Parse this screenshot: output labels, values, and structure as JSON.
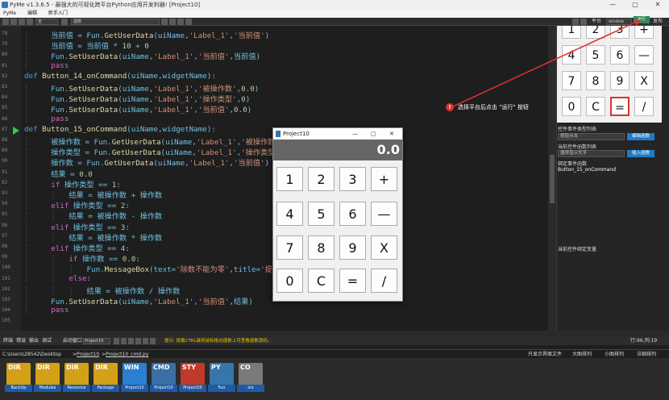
{
  "window": {
    "title": "PyMe v1.3.6.5 - 最强大的可视化跨平台Python应用开发利器! [Project10]",
    "controls": [
      "—",
      "▢",
      "✕"
    ]
  },
  "menu": [
    "PyMe",
    "编辑",
    "新手入门"
  ],
  "toolbar": {
    "file_select": "全",
    "func_select": "函数",
    "platform_label": "平台",
    "platform_value": "window",
    "run_label": "运行",
    "publish_label": "发布"
  },
  "editor": {
    "lines": [
      {
        "n": "78",
        "html": "<span class=\"guide\">┆ </span>    当前值 = Fun.<span class=\"fn\">GetUserData</span>(uiName,<span class=\"str\">'Label_1'</span>,<span class=\"str\">'当前值'</span>)"
      },
      {
        "n": "79",
        "html": "<span class=\"guide\">┆ </span>    当前值 = 当前值 * <span class=\"num\">10</span> + <span class=\"num\">0</span>"
      },
      {
        "n": "80",
        "html": "<span class=\"guide\">┆ </span>    Fun.<span class=\"fn\">SetUserData</span>(uiName,<span class=\"str\">'Label_1'</span>,<span class=\"str\">'当前值'</span>,当前值)"
      },
      {
        "n": "81",
        "html": "<span class=\"guide\">┆ </span>    <span class=\"kw\">pass</span>"
      },
      {
        "n": "82",
        "html": "<span class=\"def\">def</span> <span class=\"fn\">Button_14_onCommand</span>(uiName,widgetName):"
      },
      {
        "n": "83",
        "html": "<span class=\"guide\">┆ </span>    Fun.<span class=\"fn\">SetUserData</span>(uiName,<span class=\"str\">'Label_1'</span>,<span class=\"str\">'被操作数'</span>,<span class=\"num\">0.0</span>)"
      },
      {
        "n": "84",
        "html": "<span class=\"guide\">┆ </span>    Fun.<span class=\"fn\">SetUserData</span>(uiName,<span class=\"str\">'Label_1'</span>,<span class=\"str\">'操作类型'</span>,<span class=\"num\">0</span>)"
      },
      {
        "n": "85",
        "html": "<span class=\"guide\">┆ </span>    Fun.<span class=\"fn\">SetUserData</span>(uiName,<span class=\"str\">'Label_1'</span>,<span class=\"str\">'当前值'</span>,<span class=\"num\">0.0</span>)"
      },
      {
        "n": "86",
        "html": "<span class=\"guide\">┆ </span>    <span class=\"kw\">pass</span>"
      },
      {
        "n": "87",
        "html": "<span class=\"def\">def</span> <span class=\"fn\">Button_15_onCommand</span>(uiName,widgetName):"
      },
      {
        "n": "88",
        "html": "<span class=\"guide\">┆ </span>    被操作数 = Fun.<span class=\"fn\">GetUserData</span>(uiName,<span class=\"str\">'Label_1'</span>,<span class=\"str\">'被操作数'</span>)"
      },
      {
        "n": "89",
        "html": "<span class=\"guide\">┆ </span>    操作类型 = Fun.<span class=\"fn\">GetUserData</span>(uiName,<span class=\"str\">'Label_1'</span>,<span class=\"str\">'操作类型'</span>)"
      },
      {
        "n": "90",
        "html": "<span class=\"guide\">┆ </span>    操作数 = Fun.<span class=\"fn\">GetUserData</span>(uiName,<span class=\"str\">'Label_1'</span>,<span class=\"str\">'当前值'</span>)"
      },
      {
        "n": "91",
        "html": "<span class=\"guide\">┆ </span>    结果 = <span class=\"num\">0.0</span>"
      },
      {
        "n": "92",
        "html": "<span class=\"guide\">┆ </span>    <span class=\"kw\">if</span> 操作类型 == <span class=\"num\">1</span>:"
      },
      {
        "n": "93",
        "html": "<span class=\"guide\">┆ </span>    <span class=\"guide\">┆ </span>  结果 = 被操作数 + 操作数"
      },
      {
        "n": "94",
        "html": "<span class=\"guide\">┆ </span>    <span class=\"kw\">elif</span> 操作类型 == <span class=\"num\">2</span>:"
      },
      {
        "n": "95",
        "html": "<span class=\"guide\">┆ </span>    <span class=\"guide\">┆ </span>  结果 = 被操作数 - 操作数"
      },
      {
        "n": "96",
        "html": "<span class=\"guide\">┆ </span>    <span class=\"kw\">elif</span> 操作类型 == <span class=\"num\">3</span>:"
      },
      {
        "n": "97",
        "html": "<span class=\"guide\">┆ </span>    <span class=\"guide\">┆ </span>  结果 = 被操作数 * 操作数"
      },
      {
        "n": "98",
        "html": "<span class=\"guide\">┆ </span>    <span class=\"kw\">elif</span> 操作类型 == <span class=\"num\">4</span>:"
      },
      {
        "n": "99",
        "html": "<span class=\"guide\">┆ </span>    <span class=\"guide\">┆ </span>  <span class=\"kw\">if</span> 操作数 == <span class=\"num\">0.0</span>:"
      },
      {
        "n": "100",
        "html": "<span class=\"guide\">┆ </span>    <span class=\"guide\">┆ </span>  <span class=\"guide\">┆ </span>  Fun.<span class=\"fn\">MessageBox</span>(text=<span class=\"str\">'除数不能为零'</span>,title=<span class=\"str\">'提示'</span>"
      },
      {
        "n": "101",
        "html": "<span class=\"guide\">┆ </span>    <span class=\"guide\">┆ </span>  <span class=\"kw\">else</span>:"
      },
      {
        "n": "102",
        "html": "<span class=\"guide\">┆ </span>    <span class=\"guide\">┆ </span>  <span class=\"guide\">┆ </span>  结果 = 被操作数 / 操作数"
      },
      {
        "n": "103",
        "html": "<span class=\"guide\">┆ </span>    Fun.<span class=\"fn\">SetUserData</span>(uiName,<span class=\"str\">'Label_1'</span>,<span class=\"str\">'当前值'</span>,结果)"
      },
      {
        "n": "104",
        "html": "<span class=\"guide\">┆ </span>    <span class=\"kw\">pass</span>"
      },
      {
        "n": "105",
        "html": ""
      }
    ],
    "current_line": "87"
  },
  "preview": {
    "keys": [
      [
        "1",
        "2",
        "3",
        "+"
      ],
      [
        "4",
        "5",
        "6",
        "—"
      ],
      [
        "7",
        "8",
        "9",
        "X"
      ],
      [
        "0",
        "C",
        "=",
        "/"
      ]
    ],
    "selected_key": "="
  },
  "right_panel": {
    "event_type_label": "控件事件类型列表",
    "event_type_value": "按钮点击",
    "edit_func_btn": "编辑函数",
    "func_list_label": "当前控件函数列表",
    "func_list_value": "值得显示文字",
    "add_func_btn": "插入函数",
    "bound_label": "绑定事件函数",
    "bound_value": "Button_15_onCommand",
    "var_label": "当前控件绑定变量"
  },
  "tip": {
    "icon": "!",
    "text": "选择平台后点击 \"运行\" 按钮"
  },
  "calc": {
    "title": "Project10",
    "display": "0.0",
    "controls": [
      "—",
      "▢",
      "✕"
    ],
    "keys": [
      [
        "1",
        "2",
        "3",
        "+"
      ],
      [
        "4",
        "5",
        "6",
        "—"
      ],
      [
        "7",
        "8",
        "9",
        "X"
      ],
      [
        "0",
        "C",
        "=",
        "/"
      ]
    ]
  },
  "bottom_tabs": [
    "终端",
    "错误",
    "输出",
    "调试"
  ],
  "bottom_select_label": "启动窗口",
  "bottom_select_value": "Project10",
  "status_line": "提示: 按着CTRL键用鼠标拖动函数上可查看函数源码。",
  "cursor_pos": "行:96,列:19",
  "path": {
    "prefix": "C:\\Users\\28542\\Desktop",
    "seg1": "Project10",
    "seg2": "Project10_cmd.py"
  },
  "view_options": [
    "只显示界面文件",
    "大图排列",
    "小图排列",
    "详细排列"
  ],
  "files": [
    {
      "tag": "DIR",
      "label": "BackUp",
      "color": "#d4a017"
    },
    {
      "tag": "DIR",
      "label": "Modules",
      "color": "#d4a017"
    },
    {
      "tag": "DIR",
      "label": "Resource",
      "color": "#d4a017"
    },
    {
      "tag": "DIR",
      "label": "Package",
      "color": "#d4a017"
    },
    {
      "tag": "WIN",
      "label": "Project10",
      "color": "#2b7fd1"
    },
    {
      "tag": "CMD",
      "label": "Project10",
      "color": "#3a6ea5"
    },
    {
      "tag": "STY",
      "label": "Project10",
      "color": "#c0392b"
    },
    {
      "tag": "PY",
      "label": "Fun",
      "color": "#3776ab"
    },
    {
      "tag": "CO",
      "label": "ico",
      "color": "#7a7a7a"
    }
  ]
}
